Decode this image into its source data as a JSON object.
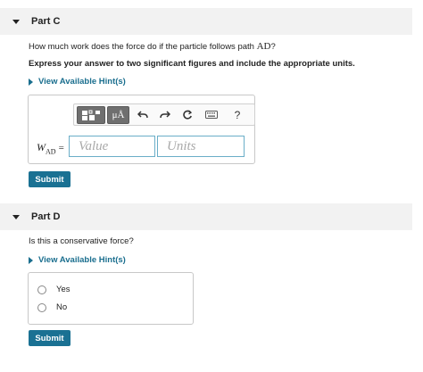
{
  "partC": {
    "title": "Part C",
    "question_prefix": "How much work does the force do if the particle follows path ",
    "question_math": "AD",
    "question_suffix": "?",
    "instruction": "Express your answer to two significant figures and include the appropriate units.",
    "hint_label": "View Available Hint(s)",
    "toolbar": {
      "units_label": "μÅ",
      "help_label": "?"
    },
    "equation_var": "W",
    "equation_sub": "AD",
    "equation_sign": "=",
    "value_placeholder": "Value",
    "units_placeholder": "Units",
    "submit_label": "Submit"
  },
  "partD": {
    "title": "Part D",
    "question": "Is this a conservative force?",
    "hint_label": "View Available Hint(s)",
    "options": [
      "Yes",
      "No"
    ],
    "submit_label": "Submit"
  }
}
